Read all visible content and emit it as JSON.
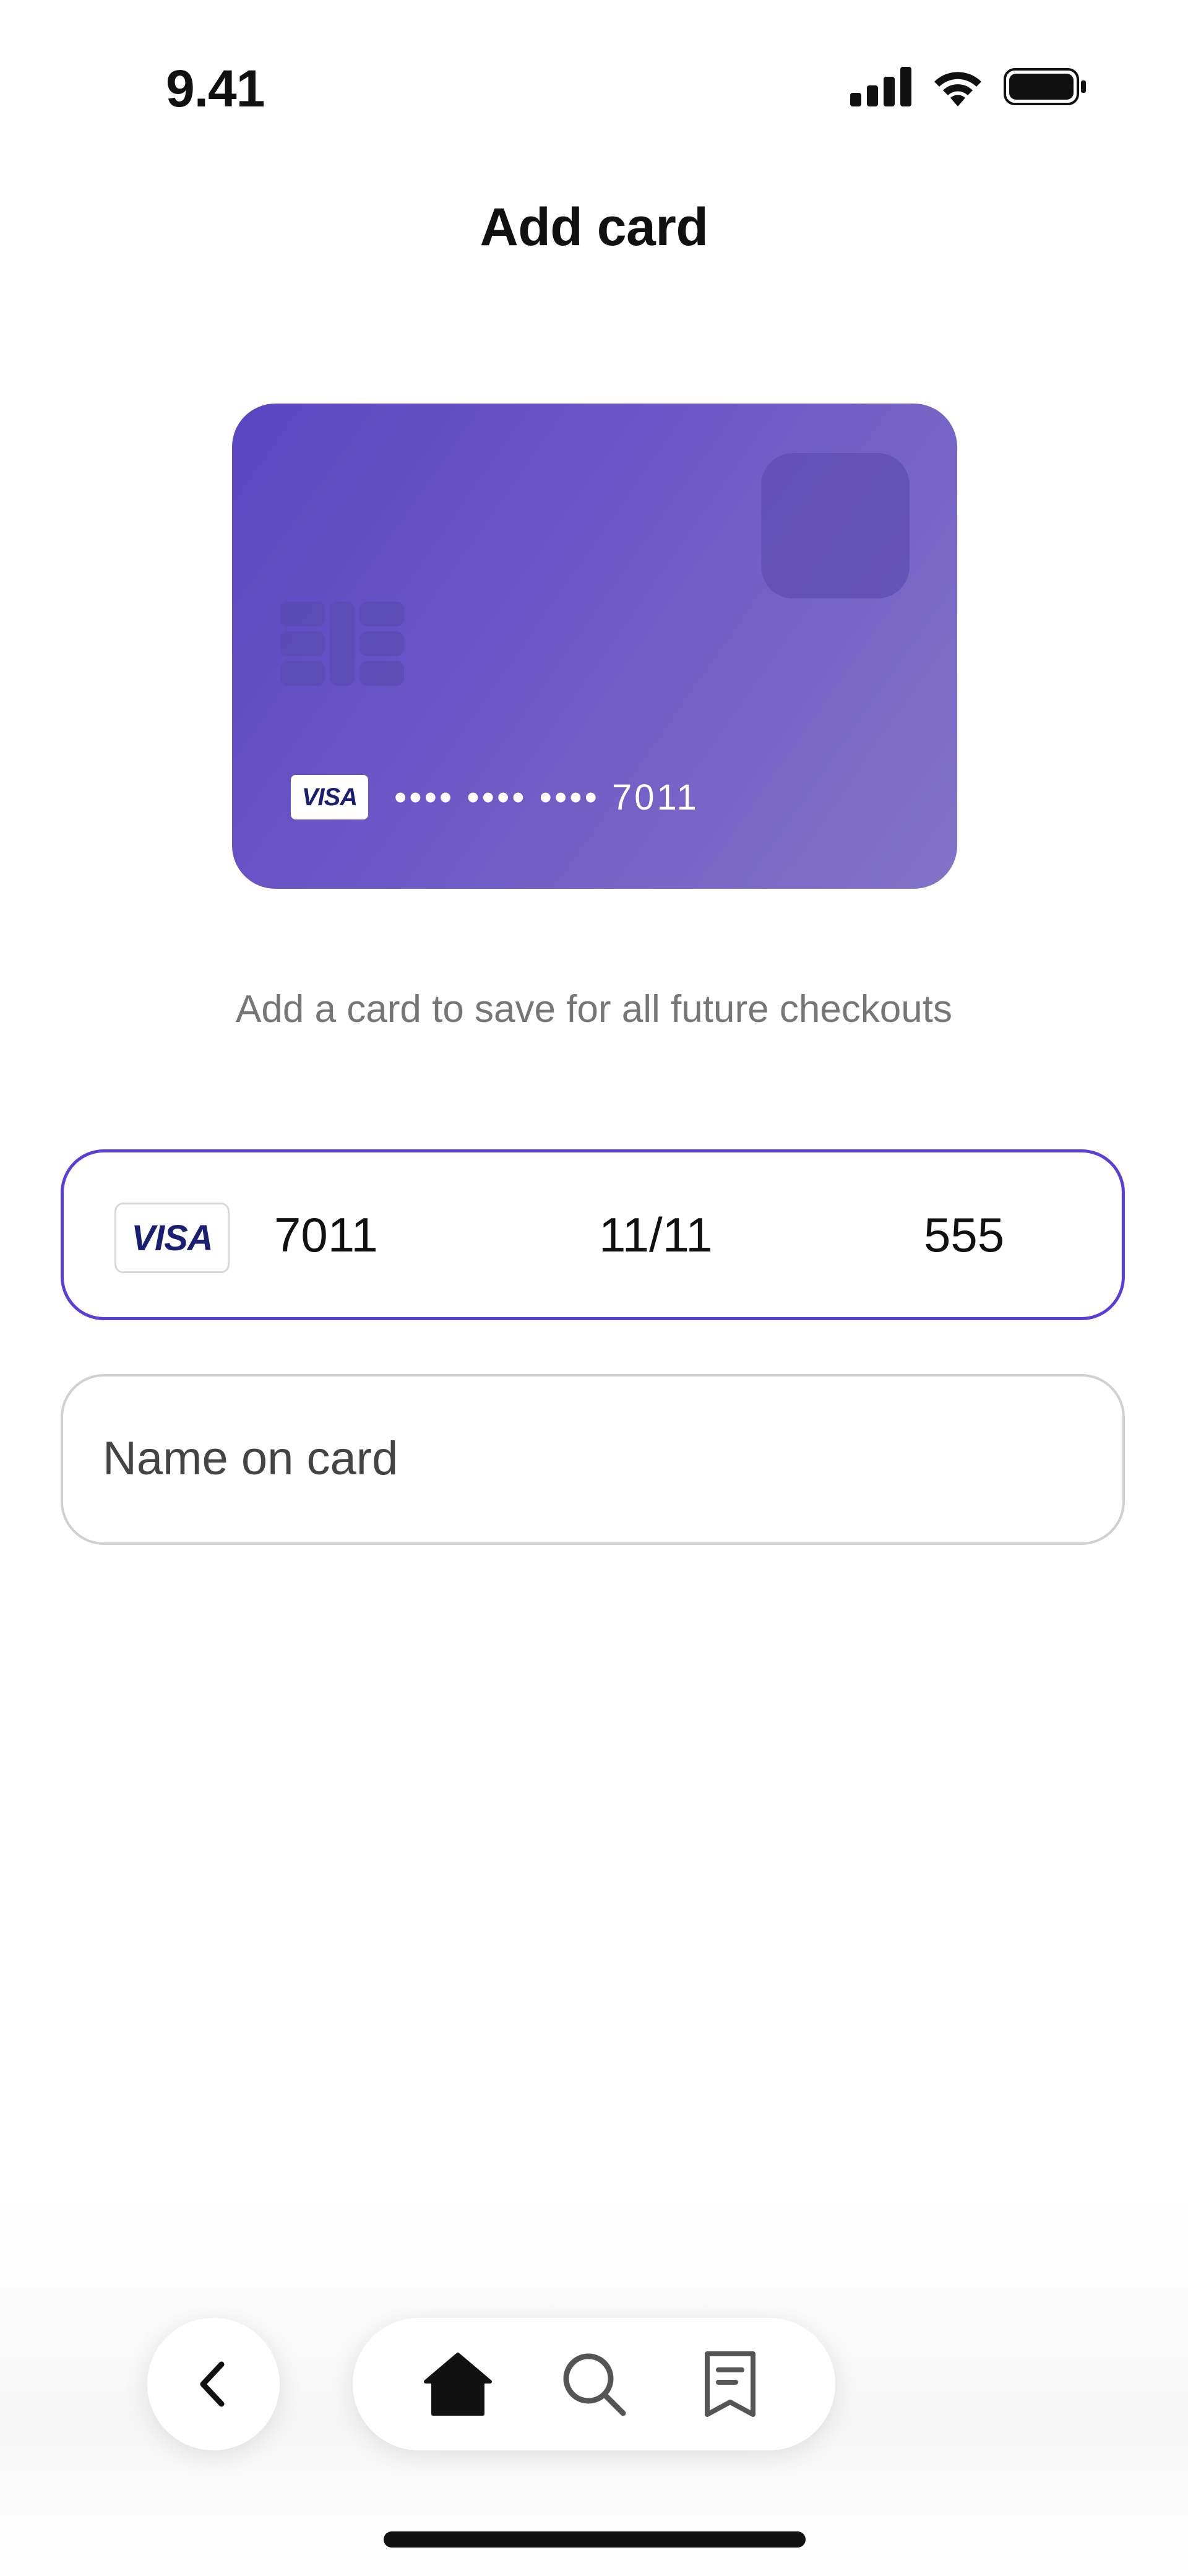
{
  "status_bar": {
    "time": "9.41"
  },
  "header": {
    "title": "Add card"
  },
  "card_preview": {
    "brand": "VISA",
    "masked_number": "•••• •••• •••• 7011",
    "accent_color": "#5a46c2"
  },
  "subtitle": "Add a card to save for all future checkouts",
  "card_form": {
    "brand": "VISA",
    "card_number": "7011",
    "expiry": "11/11",
    "cvc": "555",
    "focus_color": "#5a3fd6"
  },
  "name_field": {
    "placeholder": "Name on card",
    "value": ""
  },
  "nav": {
    "back_icon": "chevron-left-icon",
    "items": [
      {
        "icon": "home-icon",
        "active": true
      },
      {
        "icon": "search-icon",
        "active": false
      },
      {
        "icon": "receipt-icon",
        "active": false
      }
    ]
  }
}
